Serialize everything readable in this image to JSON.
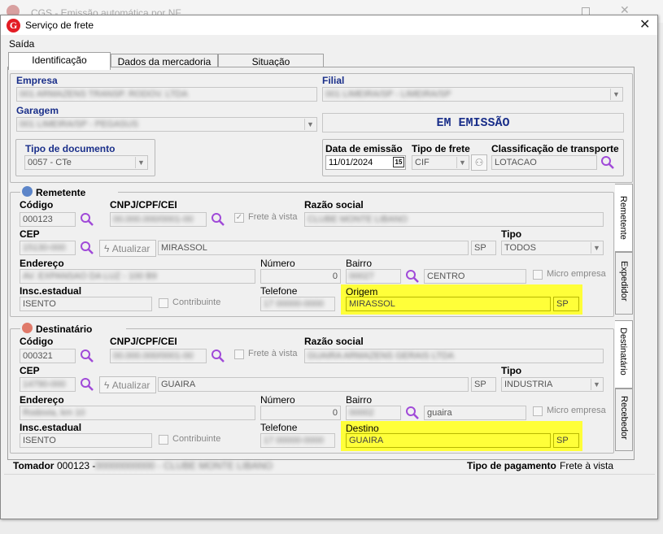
{
  "background_title": "CGS - Emissão automática por NF",
  "window": {
    "title": "Serviço de frete",
    "logo_letter": "G",
    "close": "✕"
  },
  "menu": {
    "saida": "Saída"
  },
  "tabs": [
    {
      "label": "Identificação"
    },
    {
      "label": "Dados da mercadoria"
    },
    {
      "label": "Situação"
    }
  ],
  "header": {
    "empresa_label": "Empresa",
    "empresa_value": "001 ARMAZENS TRANSP. RODOV. LTDA",
    "filial_label": "Filial",
    "filial_value": "001 LIMEIRA/SP - LIMEIRA/SP",
    "garagem_label": "Garagem",
    "garagem_value": "001 LIMEIRA/SP - PEGASUS",
    "status": "EM EMISSÃO",
    "tipo_doc_label": "Tipo de documento",
    "tipo_doc_value": "0057 - CTe",
    "data_emissao_label": "Data de emissão",
    "data_emissao_value": "11/01/2024",
    "cal_day": "15",
    "tipo_frete_label": "Tipo de frete",
    "tipo_frete_value": "CIF",
    "classif_label": "Classificação de transporte",
    "classif_value": "LOTACAO"
  },
  "labels": {
    "codigo": "Código",
    "cnpj": "CNPJ/CPF/CEI",
    "razao": "Razão social",
    "frete_vista": "Frete à vista",
    "cep": "CEP",
    "atualizar": "Atualizar",
    "tipo": "Tipo",
    "endereco": "Endereço",
    "numero": "Número",
    "bairro": "Bairro",
    "micro": "Micro empresa",
    "insc": "Insc.estadual",
    "telefone": "Telefone",
    "contribuinte": "Contribuinte"
  },
  "remetente": {
    "title": "Remetente",
    "codigo": "000123",
    "cnpj": "00.000.000/0001-00",
    "razao": "CLUBE MONTE LIBANO",
    "cep": "15130-000",
    "cidade": "MIRASSOL",
    "uf": "SP",
    "tipo": "TODOS",
    "endereco": "AV. EXPANSAO DA LUZ - 100 B9",
    "numero": "0",
    "bairro_cod": "00027",
    "bairro": "CENTRO",
    "insc": "ISENTO",
    "telefone": "17 00000-0000",
    "origem_label": "Origem",
    "origem": "MIRASSOL",
    "origem_uf": "SP"
  },
  "destinatario": {
    "title": "Destinatário",
    "codigo": "000321",
    "cnpj": "00.000.000/0001-00",
    "razao": "GUAIRA ARMAZENS GERAIS LTDA",
    "cep": "14790-000",
    "cidade": "GUAIRA",
    "uf": "SP",
    "tipo": "INDUSTRIA",
    "endereco": "Rodovia, km 10",
    "numero": "0",
    "bairro_cod": "00002",
    "bairro": "guaira",
    "insc": "ISENTO",
    "telefone": "17 00000-0000",
    "destino_label": "Destino",
    "destino": "GUAIRA",
    "destino_uf": "SP"
  },
  "side_tabs": {
    "remetente": "Remetente",
    "expedidor": "Expedidor",
    "destinatario": "Destinatário",
    "recebedor": "Recebedor"
  },
  "footer": {
    "tomador_label": "Tomador",
    "tomador_code": "000123 -",
    "tomador_name": "00000000000 - CLUBE MONTE LIBANO",
    "tipo_pag_label": "Tipo de pagamento",
    "tipo_pag_value": "Frete à vista"
  },
  "colors": {
    "highlight": "#ffff39",
    "status_text": "#1a2f8a",
    "label_blue": "#1a2f8a",
    "brand_red": "#e31c24",
    "search_icon": "#a04ad8"
  },
  "icons": [
    "search-icon",
    "calendar-icon",
    "lightning-icon",
    "person-icon",
    "checkbox-icon",
    "dropdown-arrow-icon"
  ]
}
